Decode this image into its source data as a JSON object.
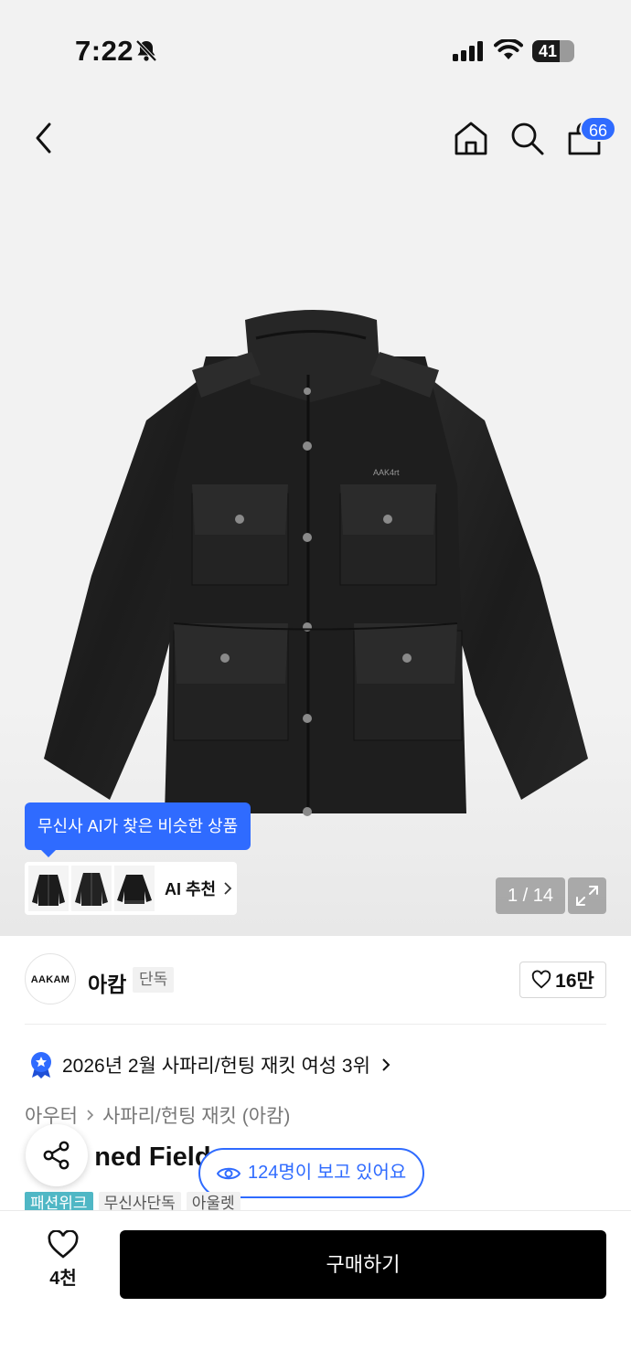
{
  "status_bar": {
    "time": "7:22",
    "battery": "41"
  },
  "header": {
    "cart_count": "66"
  },
  "gallery": {
    "ai_tooltip": "무신사 AI가 찾은 비슷한 상품",
    "ai_recommend_label": "AI 추천",
    "page_indicator": "1 / 14"
  },
  "brand": {
    "logo_text": "AAKAM",
    "name": "아캄",
    "tag": "단독",
    "likes": "16만"
  },
  "ranking": {
    "text": "2026년 2월 사파리/헌팅 재킷 여성 3위"
  },
  "breadcrumb": [
    "아우터",
    "사파리/헌팅 재킷 (아캄)"
  ],
  "product": {
    "title_visible": "ned Field",
    "viewers": "124명이 보고 있어요",
    "tags": [
      "패션위크",
      "무신사단독",
      "아울렛"
    ]
  },
  "bottom_bar": {
    "wish_count": "4천",
    "buy_label": "구매하기"
  },
  "colors": {
    "accent": "#2f6bff",
    "tag_primary": "#4fb7c5",
    "buy": "#000000"
  },
  "icons": [
    "bell-off-icon",
    "signal-icon",
    "wifi-icon",
    "battery-icon",
    "back-icon",
    "home-icon",
    "search-icon",
    "shopping-bag-icon",
    "expand-icon",
    "heart-icon",
    "medal-icon",
    "share-icon",
    "eye-icon",
    "chevron-right-icon"
  ]
}
